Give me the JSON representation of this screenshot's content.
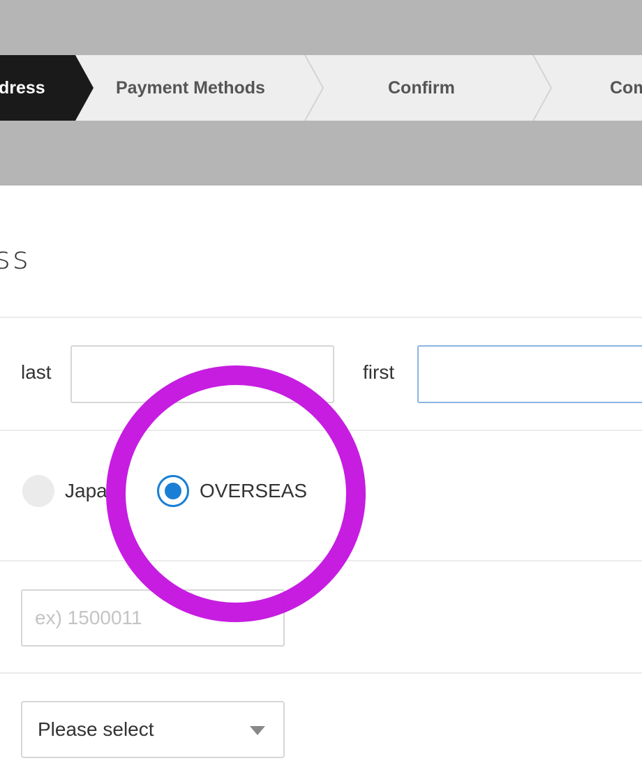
{
  "stepper": {
    "steps": [
      {
        "label": "dress",
        "state": "active"
      },
      {
        "label": "Payment Methods",
        "state": "inactive"
      },
      {
        "label": "Confirm",
        "state": "inactive"
      },
      {
        "label": "Com",
        "state": "inactive"
      }
    ]
  },
  "form": {
    "title": "ss",
    "name": {
      "last_label": "last",
      "last_value": "",
      "first_label": "first",
      "first_value": ""
    },
    "region": {
      "options": [
        {
          "label": "Japa",
          "selected": false
        },
        {
          "label": "OVERSEAS",
          "selected": true
        }
      ]
    },
    "postal": {
      "placeholder": "ex) 1500011"
    },
    "prefecture": {
      "selected": "Please select"
    }
  },
  "annotation": {
    "color": "#c414e0"
  },
  "colors": {
    "accent": "#1a7fd4",
    "active_step_bg": "#1a1a1a",
    "header_band": "#b5b5b5"
  }
}
